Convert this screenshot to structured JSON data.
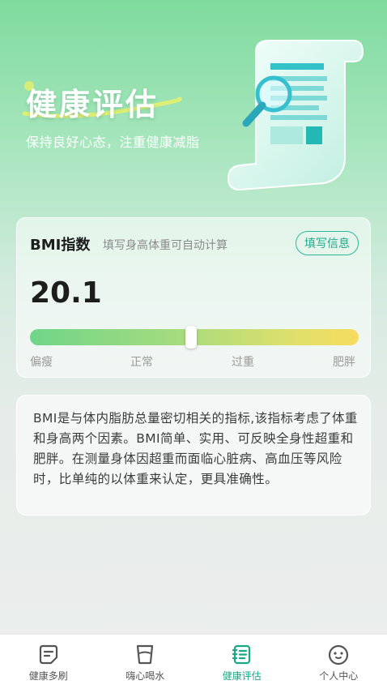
{
  "header": {
    "title": "健康评估",
    "subtitle": "保持良好心态，注重健康减脂"
  },
  "bmi": {
    "title": "BMI指数",
    "hint": "填写身高体重可自动计算",
    "fill_button": "填写信息",
    "value": "20.1",
    "indicator_position_fraction": 0.49,
    "scale_labels": [
      "偏瘦",
      "正常",
      "过重",
      "肥胖"
    ]
  },
  "info": {
    "text": "BMI是与体内脂肪总量密切相关的指标,该指标考虑了体重和身高两个因素。BMI简单、实用、可反映全身性超重和肥胖。在测量身体因超重而面临心脏病、高血压等风险时，比单纯的以体重来认定，更具准确性。"
  },
  "tabbar": {
    "tabs": [
      {
        "label": "健康多刷",
        "icon": "document-icon"
      },
      {
        "label": "嗨心喝水",
        "icon": "cup-icon"
      },
      {
        "label": "健康评估",
        "icon": "clipboard-list-icon"
      },
      {
        "label": "个人中心",
        "icon": "smiley-icon"
      }
    ],
    "active_index": 2
  },
  "colors": {
    "accent": "#19a886",
    "gradient_top": "#7fdb9e",
    "bar_start": "#6fd589",
    "bar_end": "#f6dc5f"
  }
}
